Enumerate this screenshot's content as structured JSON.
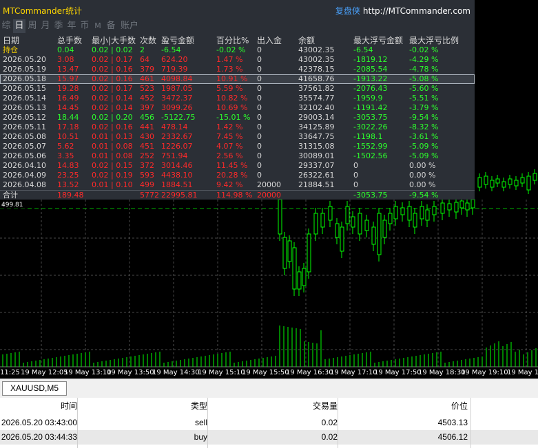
{
  "panel": {
    "title": "MTCommander统计",
    "brand": "复盘侠",
    "url": "http://MTCommander.com",
    "tabs": [
      "综",
      "日",
      "周",
      "月",
      "季",
      "年",
      "币",
      "M",
      "备",
      "账户"
    ],
    "active_tab": "日"
  },
  "table": {
    "headers": [
      "日期",
      "总手数",
      "最小|大手数",
      "次数",
      "盈亏金额",
      "百分比%",
      "出入金",
      "余额",
      "最大浮亏金额",
      "最大浮亏比例"
    ],
    "rows": [
      {
        "date": "持仓",
        "lots": "0.04",
        "minmax": "0.02 | 0.02",
        "count": "2",
        "pnl": "-6.54",
        "pct": "-0.02 %",
        "flow": "0",
        "balance": "43002.35",
        "maxfloat": "-6.54",
        "maxratio": "-0.02 %",
        "color": "green"
      },
      {
        "date": "2026.05.20",
        "lots": "3.08",
        "minmax": "0.02 | 0.17",
        "count": "64",
        "pnl": "624.20",
        "pct": "1.47 %",
        "flow": "0",
        "balance": "43002.35",
        "maxfloat": "-1819.12",
        "maxratio": "-4.29 %",
        "color": "red"
      },
      {
        "date": "2026.05.19",
        "lots": "13.47",
        "minmax": "0.02 | 0.16",
        "count": "379",
        "pnl": "719.39",
        "pct": "1.73 %",
        "flow": "0",
        "balance": "42378.15",
        "maxfloat": "-2085.54",
        "maxratio": "-4.78 %",
        "color": "red"
      },
      {
        "date": "2026.05.18",
        "lots": "15.97",
        "minmax": "0.02 | 0.16",
        "count": "461",
        "pnl": "4098.84",
        "pct": "10.91 %",
        "flow": "0",
        "balance": "41658.76",
        "maxfloat": "-1913.22",
        "maxratio": "-5.08 %",
        "color": "red"
      },
      {
        "date": "2026.05.15",
        "lots": "19.28",
        "minmax": "0.02 | 0.17",
        "count": "523",
        "pnl": "1987.05",
        "pct": "5.59 %",
        "flow": "0",
        "balance": "37561.82",
        "maxfloat": "-2076.43",
        "maxratio": "-5.60 %",
        "color": "red"
      },
      {
        "date": "2026.05.14",
        "lots": "16.49",
        "minmax": "0.02 | 0.14",
        "count": "452",
        "pnl": "3472.37",
        "pct": "10.82 %",
        "flow": "0",
        "balance": "35574.77",
        "maxfloat": "-1959.9",
        "maxratio": "-5.51 %",
        "color": "red"
      },
      {
        "date": "2026.05.13",
        "lots": "14.45",
        "minmax": "0.02 | 0.14",
        "count": "397",
        "pnl": "3099.26",
        "pct": "10.69 %",
        "flow": "0",
        "balance": "32102.40",
        "maxfloat": "-1191.42",
        "maxratio": "-3.79 %",
        "color": "red"
      },
      {
        "date": "2026.05.12",
        "lots": "18.44",
        "minmax": "0.02 | 0.20",
        "count": "456",
        "pnl": "-5122.75",
        "pct": "-15.01 %",
        "flow": "0",
        "balance": "29003.14",
        "maxfloat": "-3053.75",
        "maxratio": "-9.54 %",
        "color": "green"
      },
      {
        "date": "2026.05.11",
        "lots": "17.18",
        "minmax": "0.02 | 0.16",
        "count": "441",
        "pnl": "478.14",
        "pct": "1.42 %",
        "flow": "0",
        "balance": "34125.89",
        "maxfloat": "-3022.26",
        "maxratio": "-8.32 %",
        "color": "red"
      },
      {
        "date": "2026.05.08",
        "lots": "10.51",
        "minmax": "0.01 | 0.13",
        "count": "430",
        "pnl": "2332.67",
        "pct": "7.45 %",
        "flow": "0",
        "balance": "33647.75",
        "maxfloat": "-1198.1",
        "maxratio": "-3.61 %",
        "color": "red"
      },
      {
        "date": "2026.05.07",
        "lots": "5.62",
        "minmax": "0.01 | 0.08",
        "count": "451",
        "pnl": "1226.07",
        "pct": "4.07 %",
        "flow": "0",
        "balance": "31315.08",
        "maxfloat": "-1552.99",
        "maxratio": "-5.09 %",
        "color": "red"
      },
      {
        "date": "2026.05.06",
        "lots": "3.35",
        "minmax": "0.01 | 0.08",
        "count": "252",
        "pnl": "751.94",
        "pct": "2.56 %",
        "flow": "0",
        "balance": "30089.01",
        "maxfloat": "-1502.56",
        "maxratio": "-5.09 %",
        "color": "red"
      },
      {
        "date": "2026.04.10",
        "lots": "14.83",
        "minmax": "0.02 | 0.15",
        "count": "372",
        "pnl": "3014.46",
        "pct": "11.45 %",
        "flow": "0",
        "balance": "29337.07",
        "maxfloat": "0",
        "maxratio": "0.00 %",
        "color": "red"
      },
      {
        "date": "2026.04.09",
        "lots": "23.25",
        "minmax": "0.02 | 0.19",
        "count": "593",
        "pnl": "4438.10",
        "pct": "20.28 %",
        "flow": "0",
        "balance": "26322.61",
        "maxfloat": "0",
        "maxratio": "0.00 %",
        "color": "red"
      },
      {
        "date": "2026.04.08",
        "lots": "13.52",
        "minmax": "0.01 | 0.10",
        "count": "499",
        "pnl": "1884.51",
        "pct": "9.42 %",
        "flow": "20000",
        "balance": "21884.51",
        "maxfloat": "0",
        "maxratio": "0.00 %",
        "color": "red"
      }
    ],
    "total": {
      "date": "合计",
      "lots": "189.48",
      "count": "5772",
      "pnl": "22995.81",
      "pct": "114.98 %",
      "flow": "20000",
      "maxfloat": "-3053.75",
      "maxratio": "-9.54 %"
    }
  },
  "chart": {
    "price_label": "499.81",
    "time_ticks": [
      "11:25",
      "19 May 12:05",
      "19 May 13:10",
      "19 May 13:50",
      "19 May 14:30",
      "19 May 15:10",
      "19 May 15:50",
      "19 May 16:30",
      "19 May 17:10",
      "19 May 17:50",
      "19 May 18:30",
      "19 May 19:10",
      "19 May 19:50"
    ],
    "up_color": "#00ff00",
    "grid_color": "#4a4a4a"
  },
  "symbol_tab": "XAUUSD,M5",
  "trades": {
    "headers": [
      "时间",
      "类型",
      "交易量",
      "价位"
    ],
    "rows": [
      [
        "2026.05.20 03:43:00",
        "sell",
        "0.02",
        "4503.13"
      ],
      [
        "2026.05.20 03:44:33",
        "buy",
        "0.02",
        "4506.12"
      ]
    ]
  }
}
